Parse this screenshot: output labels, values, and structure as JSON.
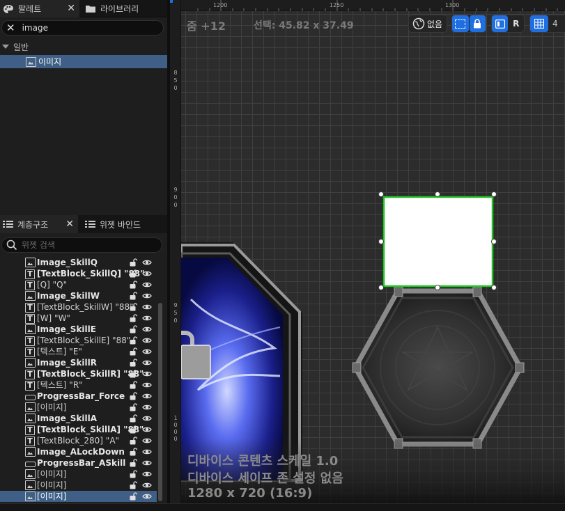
{
  "palette": {
    "tab_label": "팔레트",
    "library_tab_label": "라이브러리",
    "search_value": "image",
    "category": "일반",
    "items": [
      {
        "label": "이미지"
      }
    ]
  },
  "hierarchy": {
    "tab_label": "계층구조",
    "binding_tab_label": "위젯 바인드",
    "search_placeholder": "위젯 검색",
    "rows": [
      {
        "icon": "image",
        "label": "Image_SkillQ",
        "bold": true
      },
      {
        "icon": "text",
        "label": "[TextBlock_SkillQ] \"88\"",
        "bold": true
      },
      {
        "icon": "text",
        "label": "[Q] \"Q\"",
        "bold": false
      },
      {
        "icon": "image",
        "label": "Image_SkillW",
        "bold": true
      },
      {
        "icon": "text",
        "label": "[TextBlock_SkillW] \"88\"",
        "bold": false
      },
      {
        "icon": "text",
        "label": "[W] \"W\"",
        "bold": false
      },
      {
        "icon": "image",
        "label": "Image_SkillE",
        "bold": true
      },
      {
        "icon": "text",
        "label": "[TextBlock_SkillE] \"88\"",
        "bold": false
      },
      {
        "icon": "text",
        "label": "[텍스트] \"E\"",
        "bold": false
      },
      {
        "icon": "image",
        "label": "Image_SkillR",
        "bold": true
      },
      {
        "icon": "text",
        "label": "[TextBlock_SkillR] \"88\"",
        "bold": true
      },
      {
        "icon": "text",
        "label": "[텍스트] \"R\"",
        "bold": false
      },
      {
        "icon": "progress",
        "label": "ProgressBar_Force",
        "bold": true
      },
      {
        "icon": "image",
        "label": "[이미지]",
        "bold": false
      },
      {
        "icon": "image",
        "label": "Image_SkillA",
        "bold": true
      },
      {
        "icon": "text",
        "label": "[TextBlock_SkillA] \"88\"",
        "bold": true
      },
      {
        "icon": "text",
        "label": "[TextBlock_280] \"A\"",
        "bold": false
      },
      {
        "icon": "image",
        "label": "Image_ALockDown",
        "bold": true
      },
      {
        "icon": "progress",
        "label": "ProgressBar_ASkill",
        "bold": true
      },
      {
        "icon": "image",
        "label": "[이미지]",
        "bold": false
      },
      {
        "icon": "image",
        "label": "[이미지]",
        "bold": false
      },
      {
        "icon": "image",
        "label": "[이미지]",
        "bold": false,
        "selected": true
      }
    ]
  },
  "viewport": {
    "zoom": "줌 +12",
    "selection": "선택: 45.82 x 37.49",
    "ruler_top": [
      "1200",
      "1250",
      "1300"
    ],
    "ruler_left": [
      {
        "digits": [
          "8",
          "5",
          "0"
        ]
      },
      {
        "digits": [
          "9",
          "0",
          "0"
        ]
      },
      {
        "digits": [
          "9",
          "5",
          "0"
        ]
      },
      {
        "digits": [
          "1",
          "0",
          "0",
          "0"
        ]
      }
    ],
    "toolbar": {
      "none_label": "없음",
      "r_label": "R",
      "grid_value": "4"
    },
    "overlay": [
      "디바이스 콘텐츠 스케일 1.0",
      "디바이스 세이프 존 설정 없음",
      "1280 x 720 (16:9)"
    ]
  },
  "colors": {
    "accent": "#1f6fe0",
    "selection_outline": "#22c422",
    "selected_row": "#3f5f86"
  }
}
